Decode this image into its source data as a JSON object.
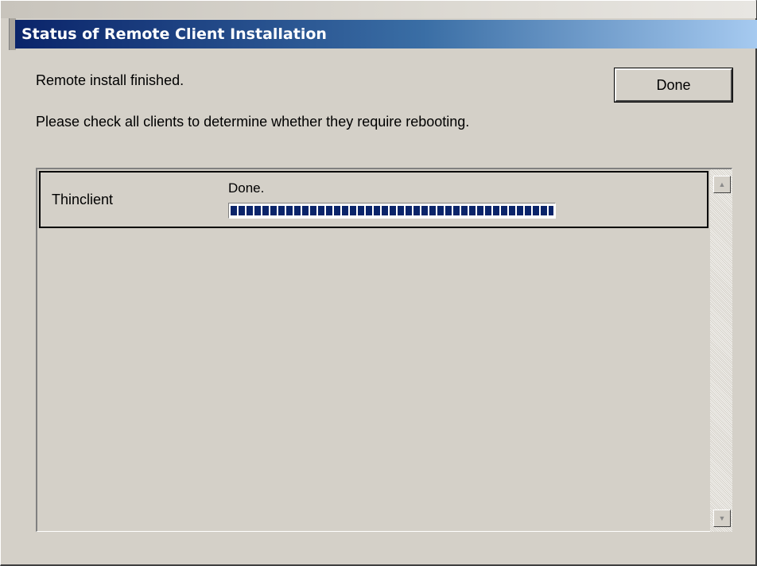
{
  "window": {
    "title": "Status of Remote Client Installation"
  },
  "messages": {
    "line1": "Remote install finished.",
    "line2": "Please check all clients to determine whether they require rebooting."
  },
  "buttons": {
    "done_label": "Done"
  },
  "clients": [
    {
      "name": "Thinclient",
      "status": "Done.",
      "progress_percent": 100
    }
  ],
  "colors": {
    "title_start": "#0a246a",
    "title_end": "#a6caf0",
    "progress_fill": "#0a246a",
    "window_bg": "#d4d0c8"
  },
  "icons": {
    "scroll_up": "scroll-up-arrow-icon",
    "scroll_down": "scroll-down-arrow-icon"
  }
}
